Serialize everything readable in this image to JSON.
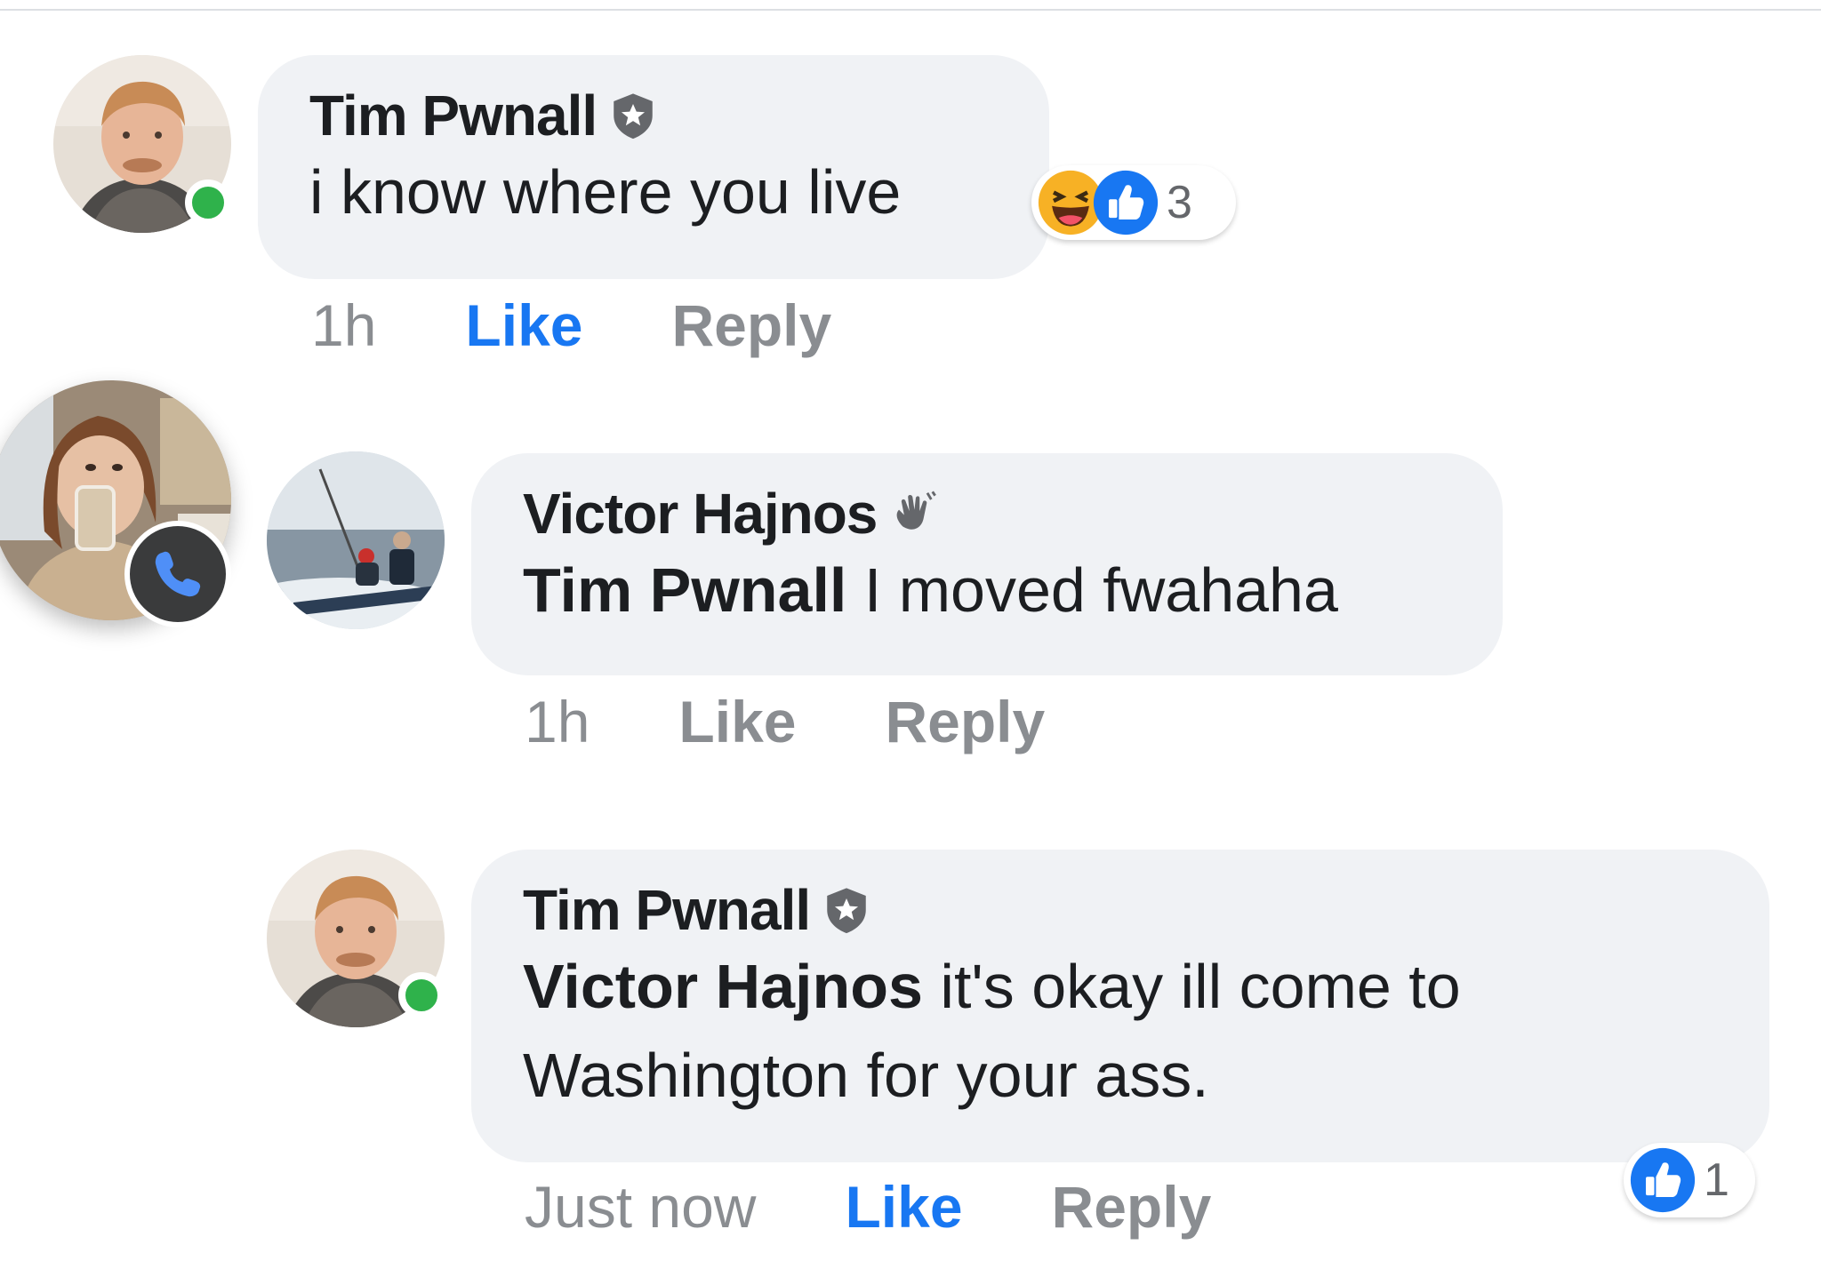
{
  "comments": [
    {
      "author": "Tim Pwnall",
      "badge": "shield-star-icon",
      "mention": "",
      "text": "i know where you live",
      "time": "1h",
      "like_label": "Like",
      "reply_label": "Reply",
      "liked": true,
      "reaction_icons": [
        "haha-icon",
        "like-icon"
      ],
      "reaction_count": "3",
      "online": true
    },
    {
      "author": "Victor Hajnos",
      "badge": "wave-icon",
      "mention": "Tim Pwnall",
      "text": "I moved fwahaha",
      "time": "1h",
      "like_label": "Like",
      "reply_label": "Reply",
      "liked": false
    },
    {
      "author": "Tim Pwnall",
      "badge": "shield-star-icon",
      "mention": "Victor Hajnos",
      "text_line1": "it's okay ill come to",
      "text_line2": "Washington for your ass.",
      "time": "Just now",
      "like_label": "Like",
      "reply_label": "Reply",
      "liked": true,
      "reaction_icons": [
        "like-icon"
      ],
      "reaction_count": "1",
      "online": true
    }
  ],
  "colors": {
    "bubble": "#f0f2f5",
    "like_blue": "#1877f2",
    "muted": "#8a8d91",
    "online_green": "#2fb24b"
  }
}
